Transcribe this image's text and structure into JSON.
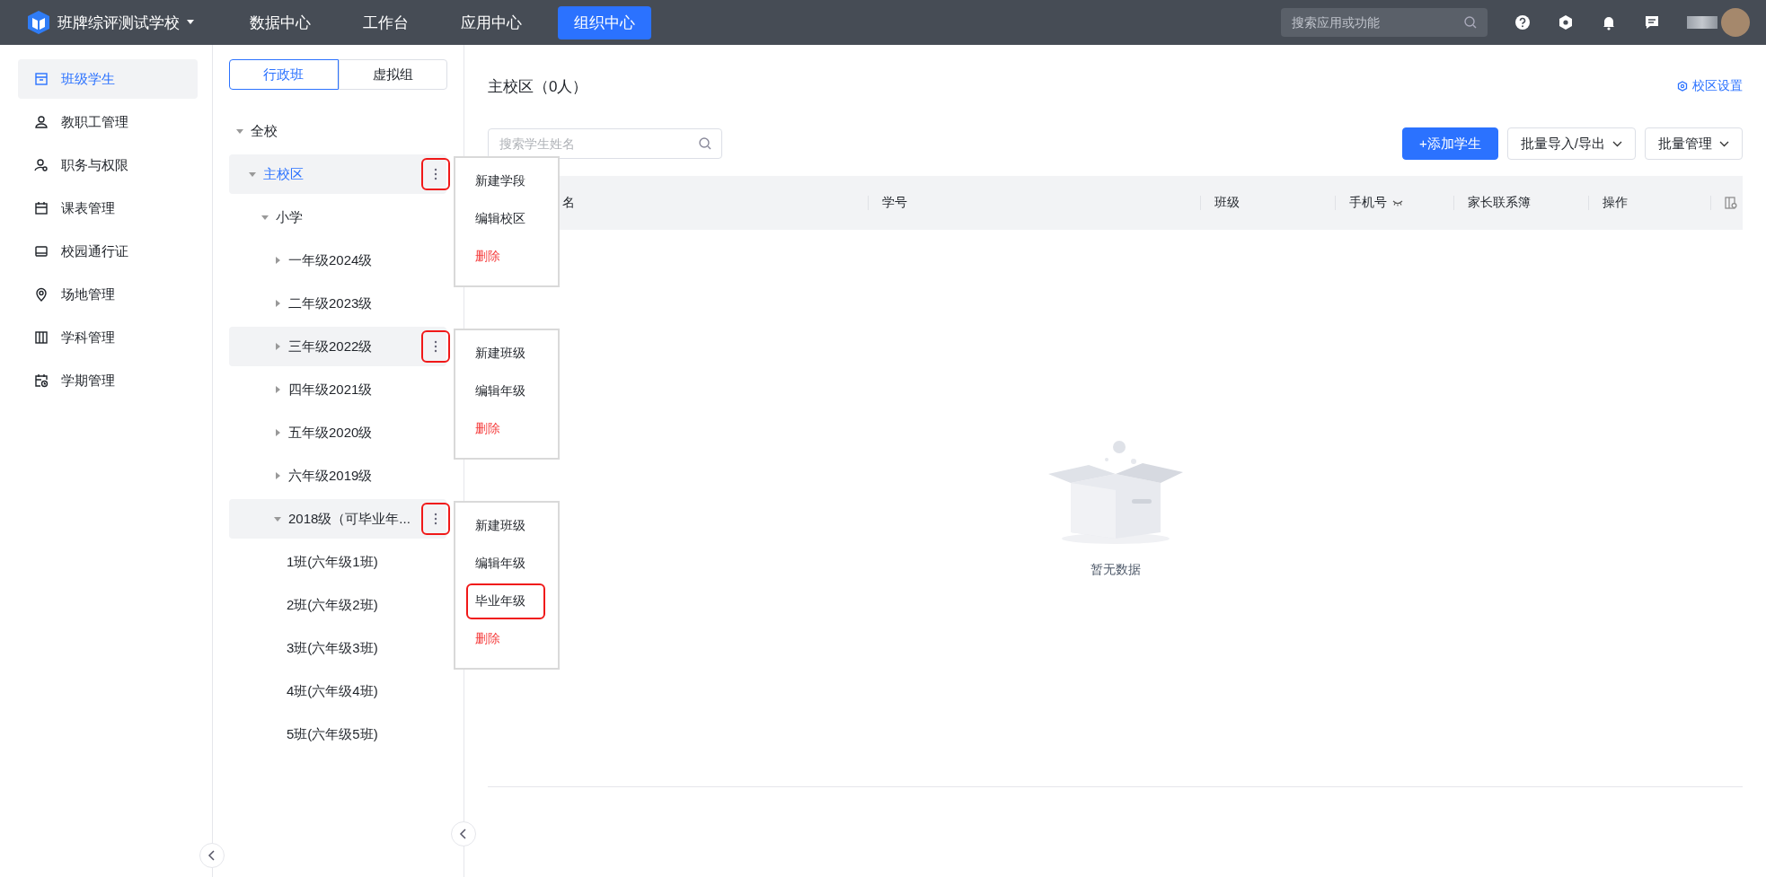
{
  "top_bar": {
    "school_name": "班牌综评测试学校",
    "nav": [
      {
        "label": "数据中心",
        "selected": false
      },
      {
        "label": "工作台",
        "selected": false
      },
      {
        "label": "应用中心",
        "selected": false
      },
      {
        "label": "组织中心",
        "selected": true
      }
    ],
    "search": {
      "placeholder": "搜索应用或功能"
    }
  },
  "sidebar": {
    "items": [
      {
        "label": "班级学生",
        "kind": "class",
        "selected": true
      },
      {
        "label": "教职工管理",
        "kind": "staff",
        "selected": false
      },
      {
        "label": "职务与权限",
        "kind": "role",
        "selected": false
      },
      {
        "label": "课表管理",
        "kind": "schedule",
        "selected": false
      },
      {
        "label": "校园通行证",
        "kind": "pass",
        "selected": false
      },
      {
        "label": "场地管理",
        "kind": "venue",
        "selected": false
      },
      {
        "label": "学科管理",
        "kind": "subject",
        "selected": false
      },
      {
        "label": "学期管理",
        "kind": "term",
        "selected": false
      }
    ]
  },
  "tree_panel": {
    "tabs": [
      {
        "label": "行政班",
        "selected": true
      },
      {
        "label": "虚拟组",
        "selected": false
      }
    ],
    "tree": [
      {
        "label": "全校",
        "expanded": true,
        "selected": false,
        "children": [
          {
            "label": "主校区",
            "expanded": true,
            "selected": true,
            "menu": {
              "annotated": true,
              "items": [
                {
                  "label": "新建学段",
                  "kind": "normal",
                  "annotated": false
                },
                {
                  "label": "编辑校区",
                  "kind": "normal",
                  "annotated": false
                },
                {
                  "label": "删除",
                  "kind": "danger",
                  "annotated": false
                }
              ]
            },
            "children": [
              {
                "label": "小学",
                "expanded": true,
                "selected": false,
                "children": [
                  {
                    "label": "一年级2024级",
                    "expanded": false,
                    "selected": false
                  },
                  {
                    "label": "二年级2023级",
                    "expanded": false,
                    "selected": false
                  },
                  {
                    "label": "三年级2022级",
                    "expanded": false,
                    "selected": false,
                    "menu": {
                      "annotated": true,
                      "items": [
                        {
                          "label": "新建班级",
                          "kind": "normal",
                          "annotated": false
                        },
                        {
                          "label": "编辑年级",
                          "kind": "normal",
                          "annotated": false
                        },
                        {
                          "label": "删除",
                          "kind": "danger",
                          "annotated": false
                        }
                      ]
                    }
                  },
                  {
                    "label": "四年级2021级",
                    "expanded": false,
                    "selected": false
                  },
                  {
                    "label": "五年级2020级",
                    "expanded": false,
                    "selected": false
                  },
                  {
                    "label": "六年级2019级",
                    "expanded": false,
                    "selected": false
                  },
                  {
                    "label": "2018级（可毕业年...",
                    "expanded": true,
                    "selected": false,
                    "menu": {
                      "annotated": true,
                      "items": [
                        {
                          "label": "新建班级",
                          "kind": "normal",
                          "annotated": false
                        },
                        {
                          "label": "编辑年级",
                          "kind": "normal",
                          "annotated": false
                        },
                        {
                          "label": "毕业年级",
                          "kind": "normal",
                          "annotated": true
                        },
                        {
                          "label": "删除",
                          "kind": "danger",
                          "annotated": false
                        }
                      ]
                    },
                    "children": [
                      {
                        "label": "1班(六年级1班)",
                        "selected": false
                      },
                      {
                        "label": "2班(六年级2班)",
                        "selected": false
                      },
                      {
                        "label": "3班(六年级3班)",
                        "selected": false
                      },
                      {
                        "label": "4班(六年级4班)",
                        "selected": false
                      },
                      {
                        "label": "5班(六年级5班)",
                        "selected": false
                      }
                    ]
                  }
                ]
              }
            ]
          }
        ]
      }
    ]
  },
  "main": {
    "title": "主校区（0人）",
    "settings_link": "校区设置",
    "search": {
      "placeholder": "搜索学生姓名"
    },
    "buttons": [
      {
        "label": "+添加学生",
        "kind": "primary"
      },
      {
        "label": "批量导入/导出",
        "kind": "dropdown"
      },
      {
        "label": "批量管理",
        "kind": "dropdown"
      }
    ],
    "table": {
      "columns": [
        {
          "label": "名",
          "kind": "text"
        },
        {
          "label": "学号",
          "kind": "text"
        },
        {
          "label": "班级",
          "kind": "text"
        },
        {
          "label": "手机号",
          "kind": "masked"
        },
        {
          "label": "家长联系簿",
          "kind": "text"
        },
        {
          "label": "操作",
          "kind": "text"
        }
      ],
      "empty_text": "暂无数据"
    }
  }
}
